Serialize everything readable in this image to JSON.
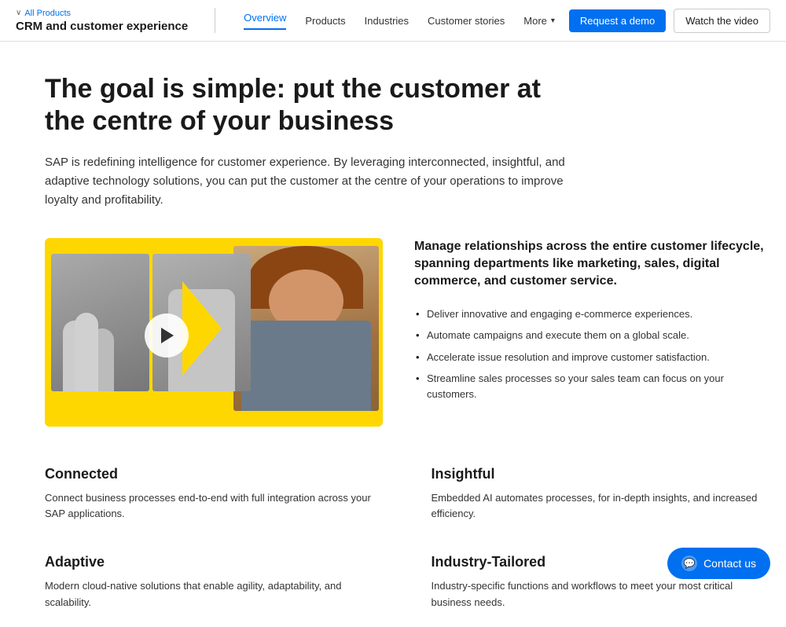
{
  "nav": {
    "breadcrumb_chevron": "∨",
    "breadcrumb_label": "All Products",
    "product_title": "CRM and customer experience",
    "links": [
      {
        "label": "Overview",
        "active": true
      },
      {
        "label": "Products",
        "active": false
      },
      {
        "label": "Industries",
        "active": false
      },
      {
        "label": "Customer stories",
        "active": false
      },
      {
        "label": "More",
        "active": false,
        "has_chevron": true
      }
    ],
    "btn_demo": "Request a demo",
    "btn_video": "Watch the video"
  },
  "hero": {
    "title": "The goal is simple: put the customer at the centre of your business",
    "description": "SAP is redefining intelligence for customer experience. By leveraging interconnected, insightful, and adaptive technology solutions, you can put the customer at the centre of your operations to improve loyalty and profitability."
  },
  "features": {
    "heading": "Manage relationships across the entire customer lifecycle, spanning departments like marketing, sales, digital commerce, and customer service.",
    "list": [
      "Deliver innovative and engaging e-commerce experiences.",
      "Automate campaigns and execute them on a global scale.",
      "Accelerate issue resolution and improve customer satisfaction.",
      "Streamline sales processes so your sales team can focus on your customers."
    ]
  },
  "cards": [
    {
      "id": "connected",
      "title": "Connected",
      "desc": "Connect business processes end-to-end with full integration across your SAP applications."
    },
    {
      "id": "insightful",
      "title": "Insightful",
      "desc": "Embedded AI  automates processes, for in-depth insights, and increased efficiency."
    },
    {
      "id": "adaptive",
      "title": "Adaptive",
      "desc": "Modern cloud-native solutions that enable agility, adaptability, and scalability."
    },
    {
      "id": "industry-tailored",
      "title": "Industry-Tailored",
      "desc": "Industry-specific functions and workflows to meet your most critical business needs."
    }
  ],
  "contact": {
    "label": "Contact us"
  }
}
